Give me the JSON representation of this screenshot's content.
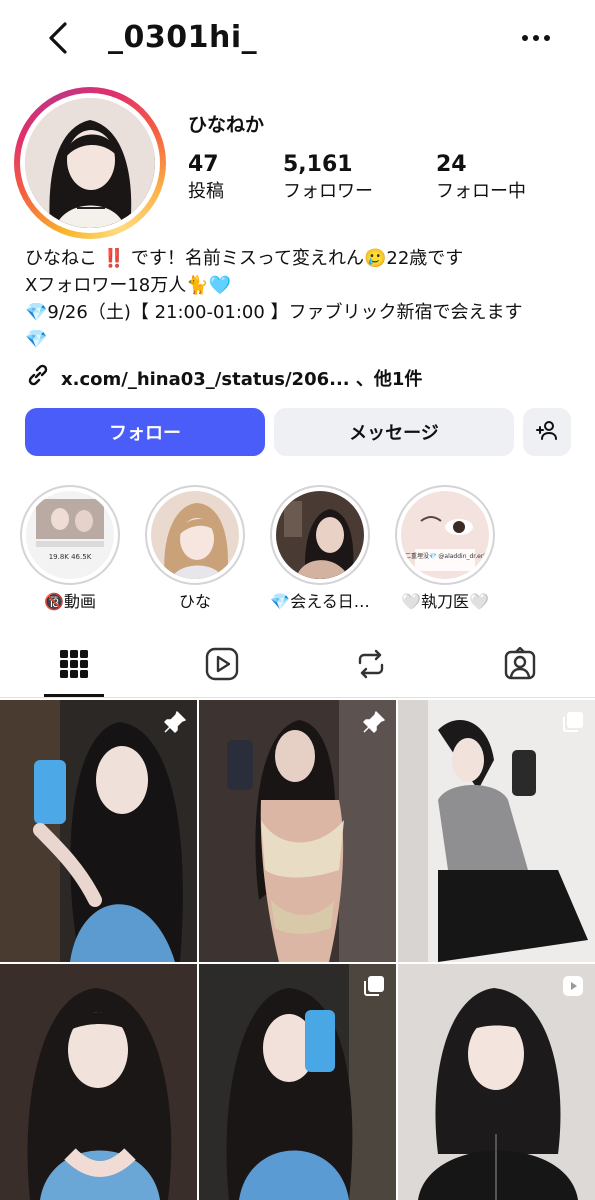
{
  "header": {
    "username": "_0301hi_",
    "back_icon": "chevron-left-icon",
    "more_icon": "more-horizontal-icon"
  },
  "profile": {
    "display_name": "ひなねか",
    "stats": [
      {
        "value": "47",
        "label": "投稿"
      },
      {
        "value": "5,161",
        "label": "フォロワー"
      },
      {
        "value": "24",
        "label": "フォロー中"
      }
    ],
    "bio": [
      "ひなねこ ‼️ です！名前ミスって変えれん🥲22歳です",
      "Xフォロワー18万人🐈🩵",
      "💎9/26（土)【 21:00-01:00 】ファブリック新宿で会えます",
      "💎"
    ],
    "link": {
      "icon": "link-icon",
      "text": "x.com/_hina03_/status/206... 、他1件"
    }
  },
  "actions": {
    "follow": "フォロー",
    "message": "メッセージ",
    "add_user_icon": "add-person-icon"
  },
  "highlights": [
    {
      "label": "🔞動画",
      "thumb_text": "19.8K   46.5K"
    },
    {
      "label": "ひな"
    },
    {
      "label": "💎会える日…"
    },
    {
      "label": "🤍執刀医🤍",
      "thumb_text": "二重埋没💎 @aladdin_dr.eri"
    }
  ],
  "tabs": [
    {
      "name": "posts-grid",
      "icon": "grid-icon",
      "active": true
    },
    {
      "name": "reels",
      "icon": "reels-icon",
      "active": false
    },
    {
      "name": "reposts",
      "icon": "repost-icon",
      "active": false
    },
    {
      "name": "tagged",
      "icon": "tagged-person-icon",
      "active": false
    }
  ],
  "grid": [
    {
      "badge": "pin-icon"
    },
    {
      "badge": "pin-icon"
    },
    {
      "badge": "carousel-icon"
    },
    {
      "badge": ""
    },
    {
      "badge": "carousel-icon"
    },
    {
      "badge": "reel-icon"
    }
  ],
  "colors": {
    "follow_button": "#4a5df9",
    "secondary_button": "#eff0f3",
    "text": "#111111"
  }
}
